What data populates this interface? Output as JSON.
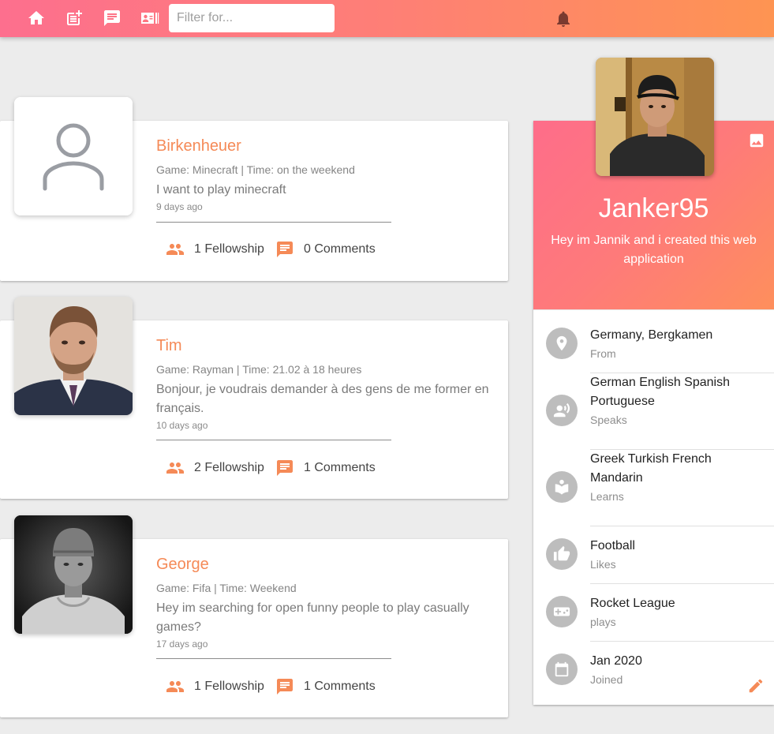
{
  "navbar": {
    "icons": [
      "home-icon",
      "post-add-icon",
      "chat-icon",
      "contacts-icon",
      "notification-bell-icon"
    ],
    "filter_placeholder": "Filter for..."
  },
  "posts": [
    {
      "name": "Birkenheuer",
      "meta": "Game: Minecraft | Time: on the weekend",
      "text": "I want to play minecraft",
      "time_ago": "9 days ago",
      "fellowship": "1 Fellowship",
      "comments": "0 Comments",
      "avatar": "default-person-icon"
    },
    {
      "name": "Tim",
      "meta": "Game: Rayman | Time: 21.02 à 18 heures",
      "text": "Bonjour, je voudrais demander à des gens de me former en français.",
      "time_ago": "10 days ago",
      "fellowship": "2 Fellowship",
      "comments": "1 Comments",
      "avatar": "photo"
    },
    {
      "name": "George",
      "meta": "Game: Fifa | Time: Weekend",
      "text": "Hey im searching for open funny people to play casually games?",
      "time_ago": "17 days ago",
      "fellowship": "1 Fellowship",
      "comments": "1 Comments",
      "avatar": "photo"
    }
  ],
  "profile": {
    "username": "Janker95",
    "bio": "Hey im Jannik and i created this web application",
    "items": [
      {
        "title": "Germany, Bergkamen",
        "label": "From",
        "icon": "location-pin-icon"
      },
      {
        "title": "German English Spanish Portuguese",
        "label": "Speaks",
        "icon": "record-voice-icon"
      },
      {
        "title": "Greek Turkish French Mandarin",
        "label": "Learns",
        "icon": "local-library-icon"
      },
      {
        "title": "Football",
        "label": "Likes",
        "icon": "thumb-up-icon"
      },
      {
        "title": "Rocket League",
        "label": "plays",
        "icon": "gamepad-icon"
      },
      {
        "title": "Jan 2020",
        "label": "Joined",
        "icon": "calendar-icon"
      }
    ]
  },
  "colors": {
    "accent": "#f58a57",
    "gradient_start": "#fd6f8e",
    "gradient_end": "#fe9452"
  }
}
